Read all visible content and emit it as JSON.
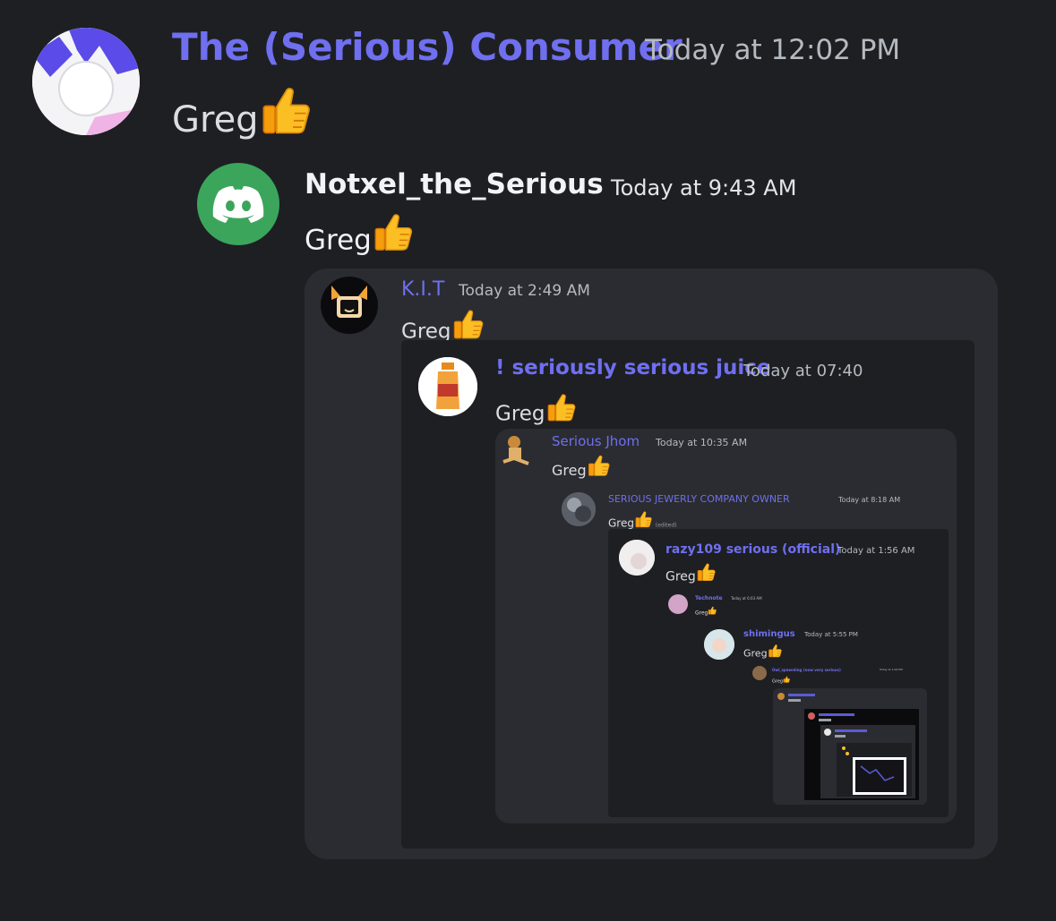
{
  "messages": [
    {
      "author": "The (Serious) Consumer",
      "timestamp": "Today at 12:02 PM",
      "text": "Greg"
    },
    {
      "author": "Notxel_the_Serious",
      "timestamp": "Today at 9:43 AM",
      "text": "Greg"
    },
    {
      "author": "K.I.T",
      "timestamp": "Today at 2:49 AM",
      "text": "Greg"
    },
    {
      "author": "! seriously serious juice",
      "timestamp": "Today at 07:40",
      "text": "Greg"
    },
    {
      "author": "Serious Jhom",
      "timestamp": "Today at 10:35 AM",
      "text": "Greg"
    },
    {
      "author": "SERIOUS JEWERLY COMPANY OWNER",
      "timestamp": "Today at 8:18 AM",
      "text": "Greg",
      "edited": "(edited)"
    },
    {
      "author": "razy109 serious (official)",
      "timestamp": "Today at 1:56 AM",
      "text": "Greg"
    },
    {
      "author": "Technote",
      "timestamp": "Today at 6:03 AM",
      "text": "Greg"
    },
    {
      "author": "shimingus",
      "timestamp": "Today at 5:55 PM",
      "text": "Greg"
    },
    {
      "author": "Owl_spawnling (now very serious)",
      "timestamp": "Today at 1:04 PM",
      "text": "Greg"
    }
  ],
  "icons": {
    "thumbs_up": "thumbs-up-emoji",
    "discord_logo": "discord-logo-icon"
  },
  "colors": {
    "background": "#1e1f23",
    "username": "#6f6ff0",
    "discord_green": "#3ba55c",
    "thumb": "#fbbf24"
  }
}
